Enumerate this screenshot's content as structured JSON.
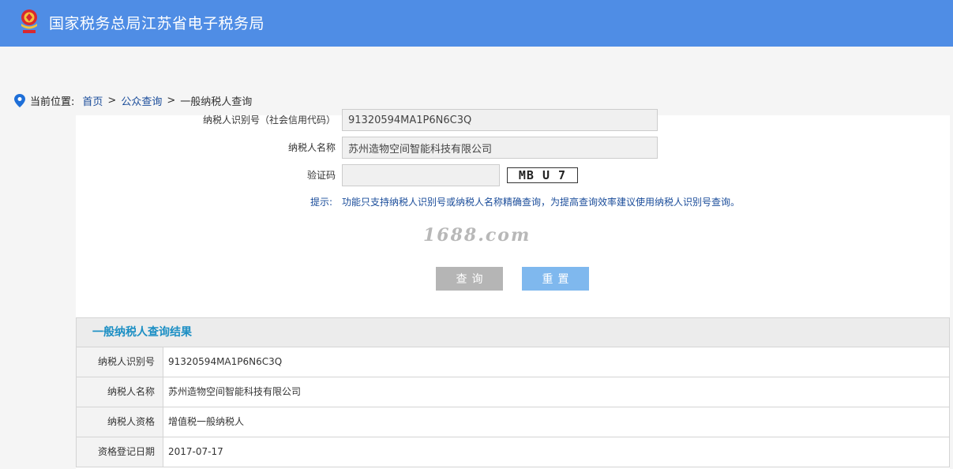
{
  "header": {
    "title": "国家税务总局江苏省电子税务局",
    "logo_icon": "tax-emblem-icon",
    "background_color": "#4f8de5"
  },
  "breadcrumb": {
    "icon": "location-pin-icon",
    "label": "当前位置:",
    "items": [
      "首页",
      "公众查询",
      "一般纳税人查询"
    ],
    "separator": ">"
  },
  "form": {
    "taxpayer_id": {
      "label": "纳税人识别号（社会信用代码）",
      "value": "91320594MA1P6N6C3Q"
    },
    "taxpayer_name": {
      "label": "纳税人名称",
      "value": "苏州造物空间智能科技有限公司"
    },
    "captcha": {
      "label": "验证码",
      "value": "",
      "image_text": "MB U 7"
    },
    "hint": {
      "label": "提示:",
      "text": "功能只支持纳税人识别号或纳税人名称精确查询，为提高查询效率建议使用纳税人识别号查询。"
    },
    "watermark": "1688.com",
    "buttons": {
      "query": "查询",
      "reset": "重置"
    }
  },
  "results": {
    "title": "一般纳税人查询结果",
    "rows": [
      {
        "label": "纳税人识别号",
        "value": "91320594MA1P6N6C3Q"
      },
      {
        "label": "纳税人名称",
        "value": "苏州造物空间智能科技有限公司"
      },
      {
        "label": "纳税人资格",
        "value": "增值税一般纳税人"
      },
      {
        "label": "资格登记日期",
        "value": "2017-07-17"
      }
    ]
  },
  "colors": {
    "accent": "#4f8de5",
    "link": "#1a4c9a",
    "result_title": "#1c8fc4",
    "query_button": "#b5b5b5",
    "reset_button": "#7fb8ee"
  }
}
